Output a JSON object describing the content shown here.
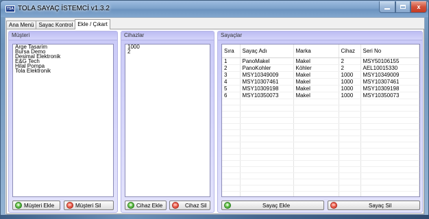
{
  "window": {
    "title": "TOLA SAYAÇ İSTEMCİ v1.3.2",
    "icon_text": "TSA",
    "min_icon": "minimize-icon",
    "max_icon": "maximize-icon",
    "close_icon": "close-icon",
    "close_glyph": "x"
  },
  "tabs": [
    {
      "label": "Ana Menü",
      "active": false
    },
    {
      "label": "Sayac Kontrol",
      "active": false
    },
    {
      "label": "Ekle / Çıkart",
      "active": true
    }
  ],
  "musteri": {
    "title": "Müşteri",
    "items": [
      "Arge Tasarim",
      "Bursa Demo",
      "Desimal Elektronik",
      "E&G Tech",
      "Hilal Pompa",
      "Tola Elektronik"
    ],
    "add_label": "Müşteri Ekle",
    "del_label": "Müşteri Sil"
  },
  "cihazlar": {
    "title": "Cihazlar",
    "items": [
      "1000",
      "2"
    ],
    "add_label": "Cihaz Ekle",
    "del_label": "Cihaz Sil"
  },
  "sayaclar": {
    "title": "Sayaçlar",
    "columns": [
      "Sıra",
      "Sayaç Adı",
      "Marka",
      "Cihaz",
      "Seri No"
    ],
    "rows": [
      [
        "1",
        "PanoMakel",
        "Makel",
        "2",
        "MSY50106155"
      ],
      [
        "2",
        "PanoKohler",
        "Köhler",
        "2",
        "AEL10015330"
      ],
      [
        "3",
        "MSY10349009",
        "Makel",
        "1000",
        "MSY10349009"
      ],
      [
        "4",
        "MSY10307461",
        "Makel",
        "1000",
        "MSY10307461"
      ],
      [
        "5",
        "MSY10309198",
        "Makel",
        "1000",
        "MSY10309198"
      ],
      [
        "6",
        "MSY10350073",
        "Makel",
        "1000",
        "MSY10350073"
      ]
    ],
    "add_label": "Sayaç Ekle",
    "del_label": "Sayaç Sil"
  },
  "icons": {
    "add": "plus-circle-icon",
    "remove": "minus-circle-icon"
  },
  "colors": {
    "add": "#2f9a1f",
    "remove": "#d3301e",
    "group_bg": "#c9c9f7"
  }
}
